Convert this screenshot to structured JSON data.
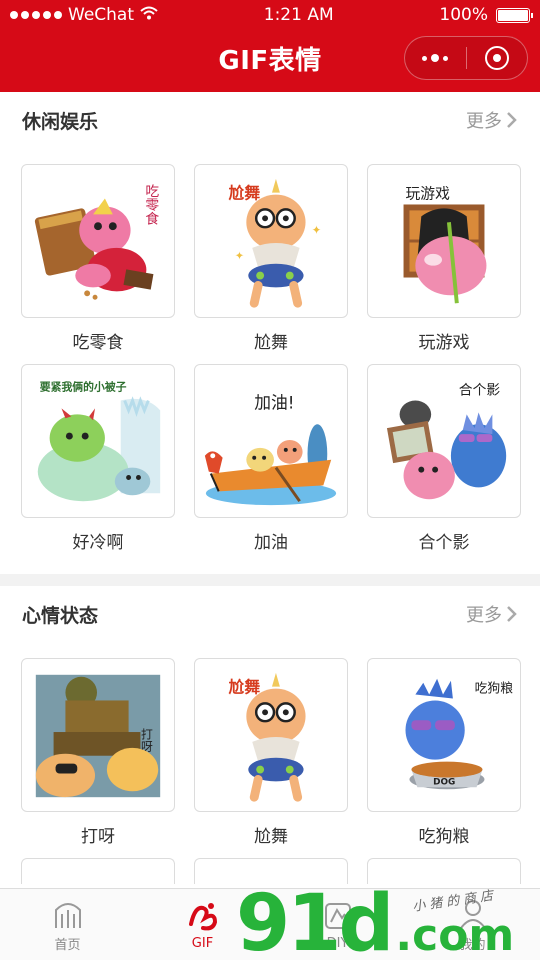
{
  "status": {
    "carrier": "WeChat",
    "time": "1:21 AM",
    "battery": "100%"
  },
  "nav": {
    "title": "GIF表情"
  },
  "sections": [
    {
      "title": "休闲娱乐",
      "more": "更多",
      "items": [
        {
          "caption": "吃零食",
          "art_text": "吃零食"
        },
        {
          "caption": "尬舞",
          "art_text": "尬舞"
        },
        {
          "caption": "玩游戏",
          "art_text": "玩游戏"
        },
        {
          "caption": "好冷啊",
          "art_text": "要紧我俩的小被子"
        },
        {
          "caption": "加油",
          "art_text": "加油!"
        },
        {
          "caption": "合个影",
          "art_text": "合个影"
        }
      ]
    },
    {
      "title": "心情状态",
      "more": "更多",
      "items": [
        {
          "caption": "打呀",
          "art_text": "打呀"
        },
        {
          "caption": "尬舞",
          "art_text": "尬舞"
        },
        {
          "caption": "吃狗粮",
          "art_text": "吃狗粮"
        }
      ]
    }
  ],
  "tabbar": [
    {
      "label": "首页",
      "icon": "home-icon",
      "active": false
    },
    {
      "label": "GIF",
      "icon": "gif-icon",
      "active": true
    },
    {
      "label": "DIY",
      "icon": "diy-icon",
      "active": false
    },
    {
      "label": "我的",
      "icon": "profile-icon",
      "active": false
    }
  ],
  "watermark": {
    "big": "91",
    "big2": "d",
    "dotcom": ".com",
    "small": "小猪的商店"
  },
  "colors": {
    "brand_red": "#d60a17",
    "watermark_green": "#27b33a"
  }
}
